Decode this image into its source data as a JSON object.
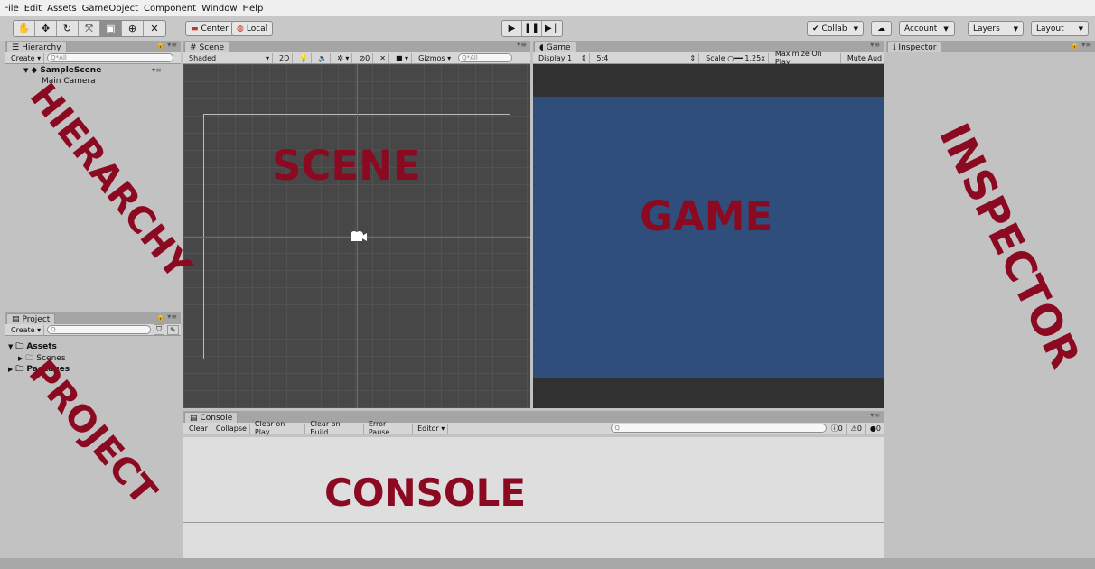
{
  "menu": [
    "File",
    "Edit",
    "Assets",
    "GameObject",
    "Component",
    "Window",
    "Help"
  ],
  "toolbar": {
    "tools": [
      {
        "name": "hand-tool",
        "glyph": "✋"
      },
      {
        "name": "move-tool",
        "glyph": "✥"
      },
      {
        "name": "rotate-tool",
        "glyph": "↻"
      },
      {
        "name": "scale-tool",
        "glyph": "⤧"
      },
      {
        "name": "rect-tool",
        "glyph": "▣"
      },
      {
        "name": "transform-tool",
        "glyph": "⊕"
      },
      {
        "name": "custom-tool",
        "glyph": "✕"
      }
    ],
    "pivot": "Center",
    "space": "Local",
    "collab": "Collab",
    "account": "Account",
    "layers": "Layers",
    "layout": "Layout"
  },
  "hierarchy": {
    "tab": "Hierarchy",
    "create": "Create",
    "search_placeholder": "Q*All",
    "scene": "SampleScene",
    "items": [
      "Main Camera"
    ],
    "overlay": "HIERARCHY"
  },
  "project": {
    "tab": "Project",
    "create": "Create",
    "root": "Assets",
    "folders": [
      "Scenes",
      "Packages"
    ],
    "overlay": "PROJECT"
  },
  "scene": {
    "tab": "Scene",
    "shading": "Shaded",
    "mode_2d": "2D",
    "gizmos": "Gizmos",
    "fx_count": "0",
    "search_placeholder": "Q*All",
    "overlay": "SCENE"
  },
  "game": {
    "tab": "Game",
    "display": "Display 1",
    "aspect": "5:4",
    "scale_label": "Scale",
    "scale_value": "1.25x",
    "maximize": "Maximize On Play",
    "mute": "Mute Aud",
    "overlay": "GAME"
  },
  "inspector": {
    "tab": "Inspector",
    "overlay": "INSPECTOR"
  },
  "console": {
    "tab": "Console",
    "buttons": [
      "Clear",
      "Collapse",
      "Clear on Play",
      "Clear on Build",
      "Error Pause",
      "Editor"
    ],
    "counts": {
      "log": "0",
      "warn": "0",
      "error": "0"
    },
    "overlay": "CONSOLE"
  },
  "colors": {
    "overlay_text": "#8b0a22",
    "game_background": "#2f4e7b",
    "scene_background": "#474747"
  }
}
